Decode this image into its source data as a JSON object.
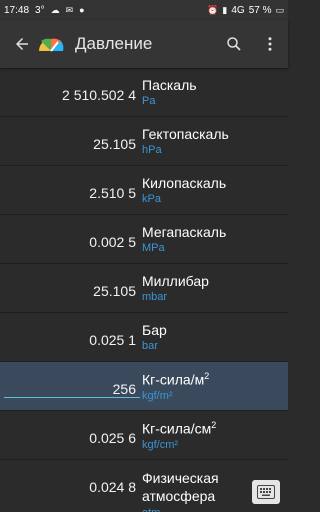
{
  "status": {
    "time": "17:48",
    "temp": "3°",
    "network": "4G",
    "battery": "57 %"
  },
  "appbar": {
    "title": "Давление",
    "icons": [
      "back-arrow-icon",
      "app-logo-icon",
      "search-icon",
      "more-vert-icon"
    ]
  },
  "units": [
    {
      "value": "2 510.502 4",
      "name": "Паскаль",
      "symbol": "Pa"
    },
    {
      "value": "25.105",
      "name": "Гектопаскаль",
      "symbol": "hPa"
    },
    {
      "value": "2.510 5",
      "name": "Килопаскаль",
      "symbol": "kPa"
    },
    {
      "value": "0.002 5",
      "name": "Мегапаскаль",
      "symbol": "MPa"
    },
    {
      "value": "25.105",
      "name": "Миллибар",
      "symbol": "mbar"
    },
    {
      "value": "0.025 1",
      "name": "Бар",
      "symbol": "bar"
    },
    {
      "value": "256",
      "name": "Кг-сила/м",
      "sup": "2",
      "symbol": "kgf/m²",
      "selected": true
    },
    {
      "value": "0.025 6",
      "name": "Кг-сила/см",
      "sup": "2",
      "symbol": "kgf/cm²"
    },
    {
      "value": "0.024 8",
      "name": "Физическая атмосфера",
      "symbol": "atm"
    }
  ],
  "colors": {
    "accent": "#3b96d6",
    "selected_bg": "#3a4a5c"
  }
}
